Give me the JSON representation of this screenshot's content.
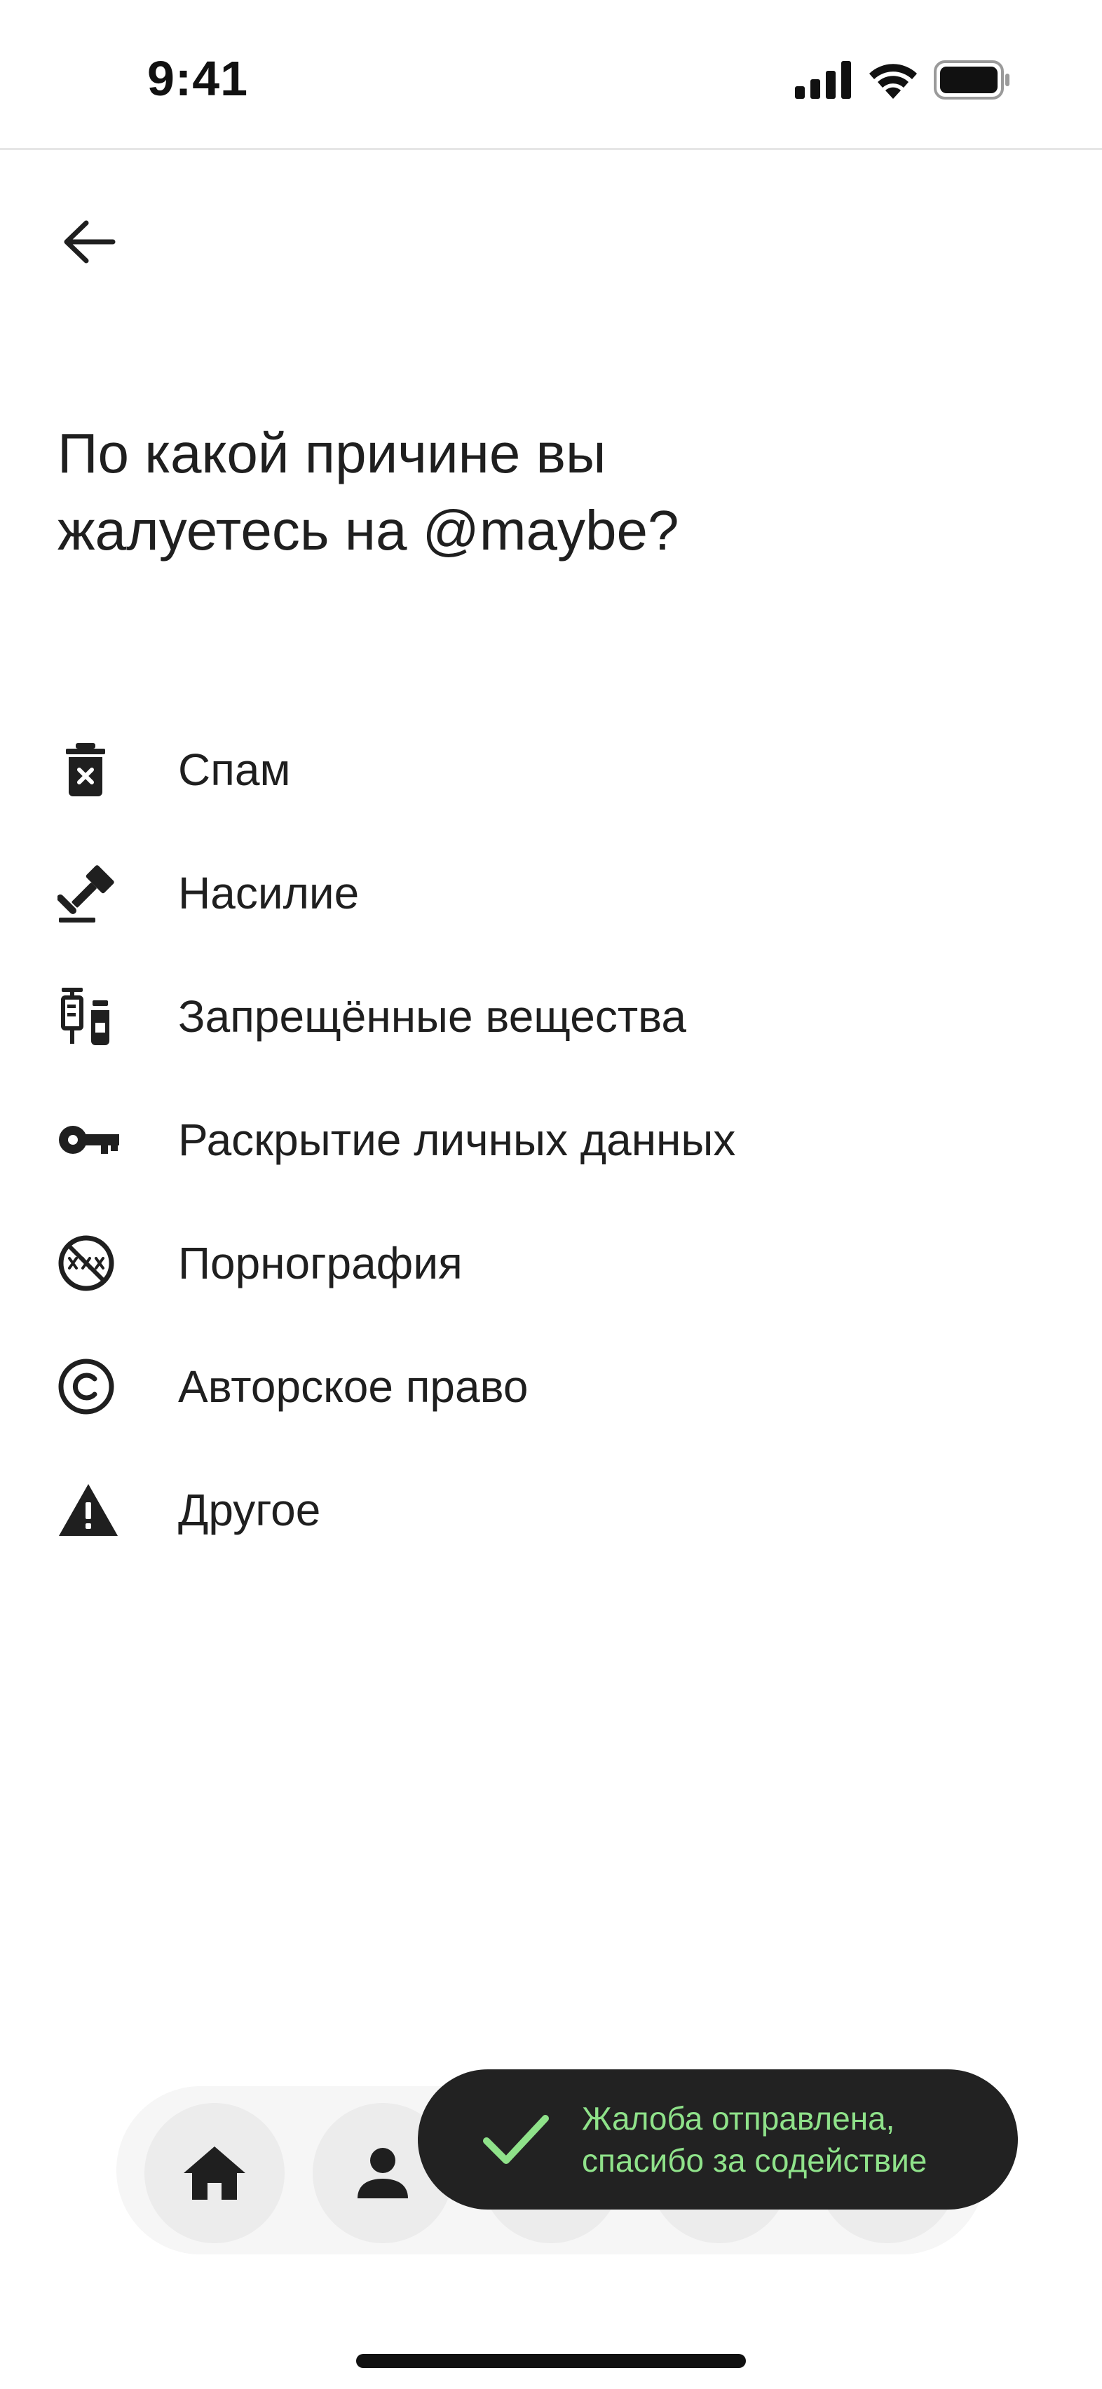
{
  "status_bar": {
    "time": "9:41"
  },
  "header": {
    "back_icon": "arrow-left-icon"
  },
  "page": {
    "title_line1": "По какой причине вы",
    "title_line2": "жалуетесь на @maybe?"
  },
  "reasons": [
    {
      "label": "Спам",
      "icon": "trash-x-icon"
    },
    {
      "label": "Насилие",
      "icon": "gavel-icon"
    },
    {
      "label": "Запрещённые вещества",
      "icon": "syringe-vial-icon"
    },
    {
      "label": "Раскрытие личных данных",
      "icon": "key-icon"
    },
    {
      "label": "Порнография",
      "icon": "xxx-forbidden-icon"
    },
    {
      "label": "Авторское право",
      "icon": "copyright-icon"
    },
    {
      "label": "Другое",
      "icon": "warning-icon"
    }
  ],
  "bottom_nav": {
    "items": [
      "home-icon",
      "profile-icon"
    ]
  },
  "toast": {
    "line1": "Жалоба отправлена,",
    "line2": "спасибо за содействие",
    "color": "#8fe28a"
  }
}
